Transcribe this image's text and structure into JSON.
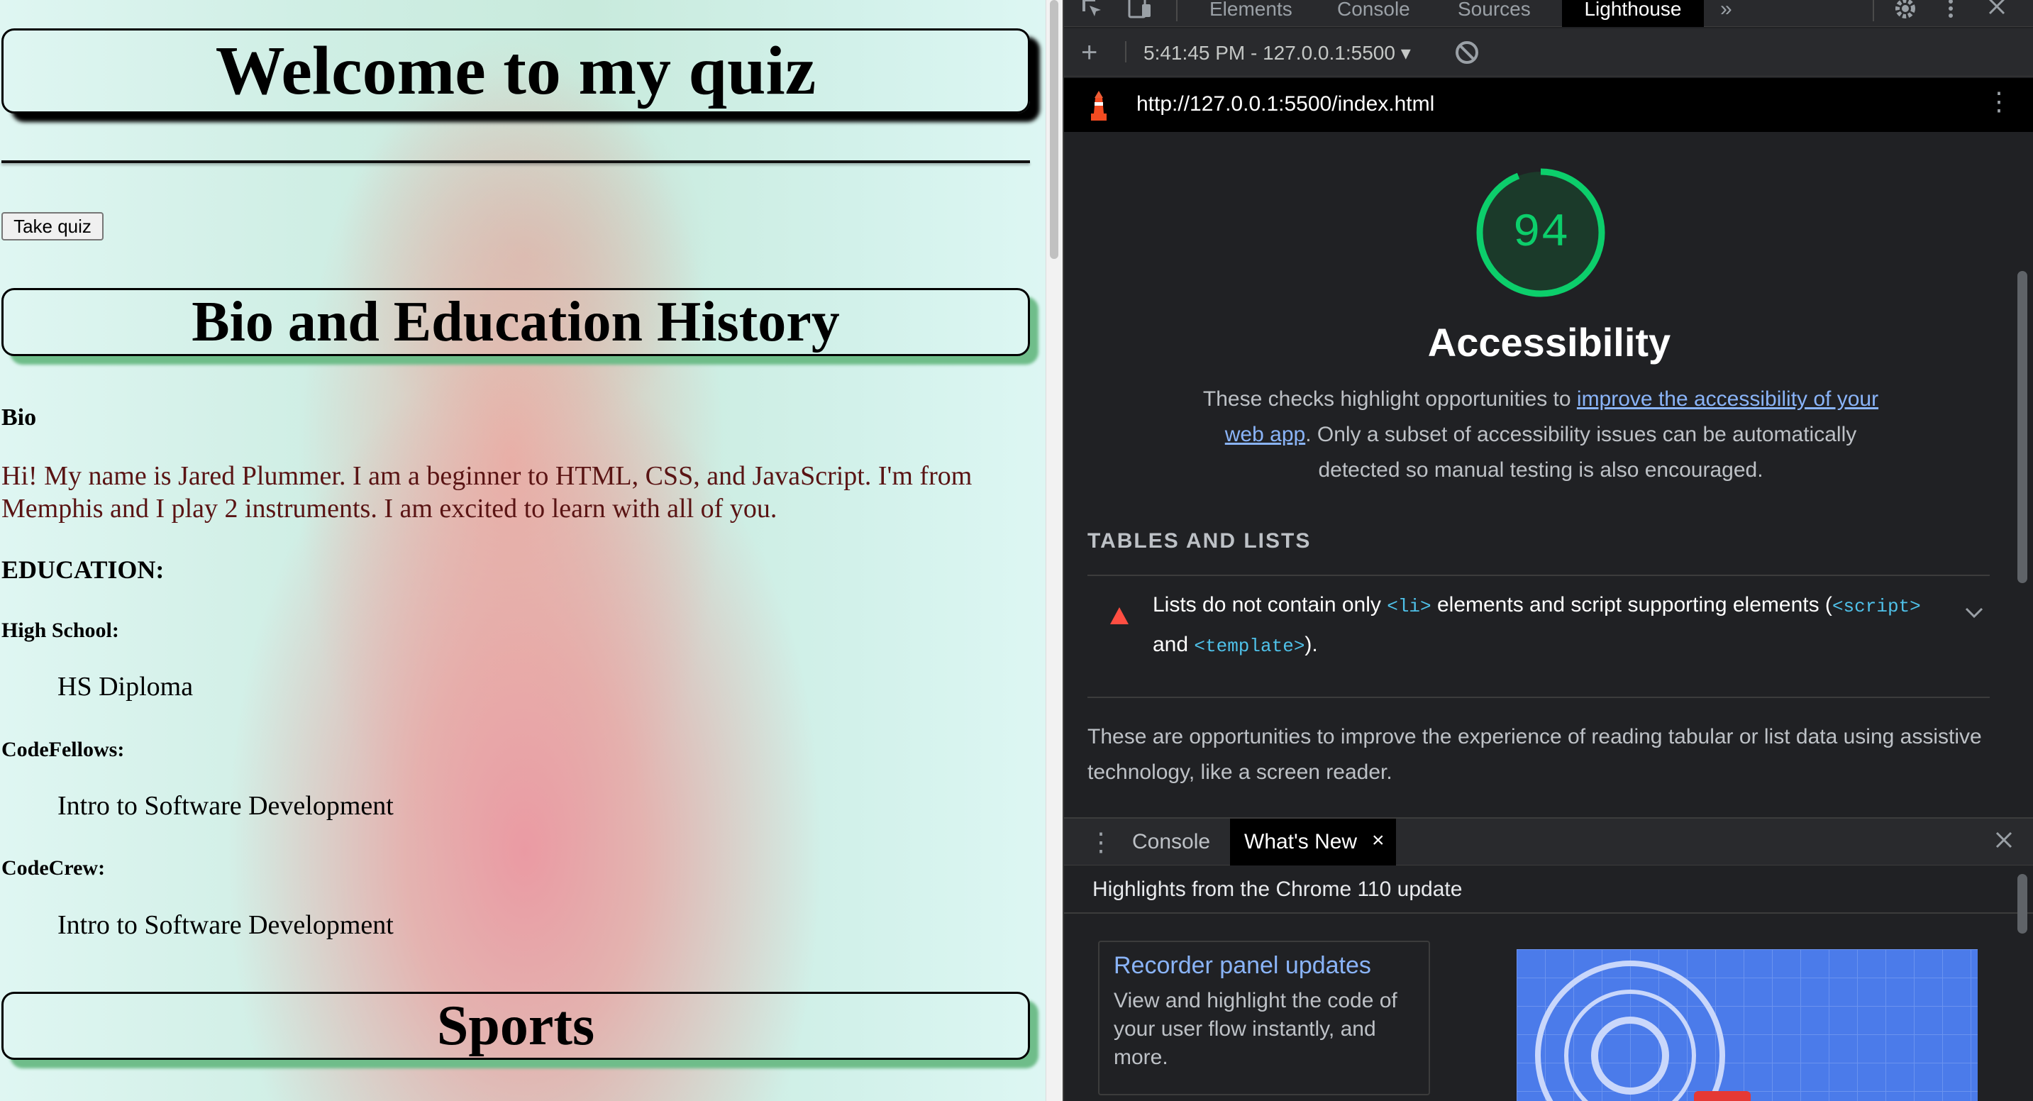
{
  "page": {
    "welcome_heading": "Welcome to my quiz",
    "take_quiz_button": "Take quiz",
    "bio_heading": "Bio and Education History",
    "bio_label": "Bio",
    "bio_text": "Hi! My name is Jared Plummer. I am a beginner to HTML, CSS, and JavaScript. I'm from Memphis and I play 2 instruments. I am excited to learn with all of you.",
    "education_label": "EDUCATION:",
    "education": [
      {
        "label": "High School:",
        "value": "HS Diploma"
      },
      {
        "label": "CodeFellows:",
        "value": "Intro to Software Development"
      },
      {
        "label": "CodeCrew:",
        "value": "Intro to Software Development"
      }
    ],
    "sports_heading": "Sports",
    "colors": {
      "bio_text": "#5a1414",
      "heading_shadow_green": "#6fbd8a"
    }
  },
  "devtools": {
    "tabs": [
      "Elements",
      "Console",
      "Sources",
      "Lighthouse"
    ],
    "active_tab": "Lighthouse",
    "more_tabs": "»",
    "report_select": "5:41:45 PM - 127.0.0.1:5500 ▾",
    "url": "http://127.0.0.1:5500/index.html",
    "icons": [
      "inspect-icon",
      "device-toggle-icon",
      "settings-icon",
      "kebab-menu-icon",
      "close-icon",
      "add-icon",
      "block-icon",
      "lighthouse-logo-icon"
    ]
  },
  "lighthouse": {
    "score": "94",
    "score_fraction": 0.94,
    "score_color": "#0cce6b",
    "category_title": "Accessibility",
    "description_before": "These checks highlight opportunities to ",
    "description_link": "improve the accessibility of your web app",
    "description_after": ". Only a subset of accessibility issues can be automatically detected so manual testing is also encouraged.",
    "group_title": "TABLES AND LISTS",
    "audit": {
      "part1": "Lists do not contain only ",
      "code1": "<li>",
      "part2": " elements and script supporting elements (",
      "code2": "<script>",
      "part3": " and ",
      "code3": "<template>",
      "part4": ").",
      "status_color": "#ff4e42"
    },
    "group_description": "These are opportunities to improve the experience of reading tabular or list data using assistive technology, like a screen reader."
  },
  "drawer": {
    "tabs": [
      "Console",
      "What's New"
    ],
    "active_tab": "What's New",
    "close_glyph": "×",
    "header": "Highlights from the Chrome 110 update",
    "card_title": "Recorder panel updates",
    "card_description": "View and highlight the code of your user flow instantly, and more."
  }
}
